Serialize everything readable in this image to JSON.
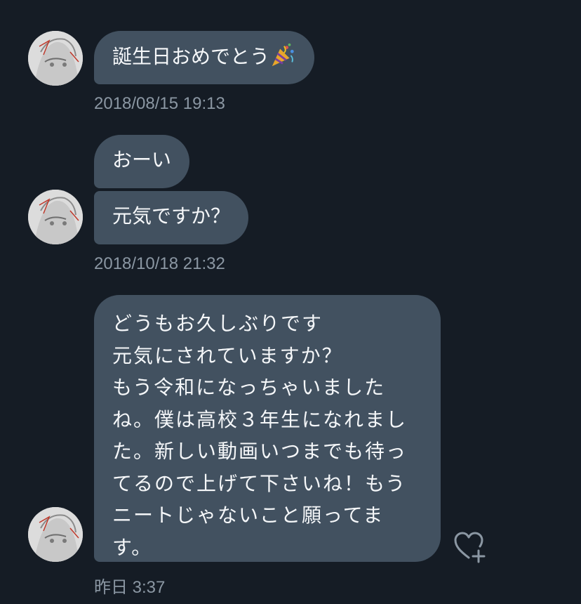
{
  "conversation": {
    "messages": [
      {
        "text": "誕生日おめでとう"
      },
      {
        "text": "おーい"
      },
      {
        "text": "元気ですか？"
      },
      {
        "lines": [
          "どうもお久しぶりです",
          "元気にされていますか？",
          "もう令和になっちゃいました",
          "ね。僕は高校３年生になれまし",
          "た。新しい動画いつまでも待っ",
          "てるので上げて下さいね！もう",
          "ニートじゃないこと願ってま",
          "す。"
        ]
      }
    ],
    "timestamps": [
      "2018/08/15 19:13",
      "2018/10/18 21:32",
      "昨日 3:37"
    ],
    "icons": {
      "avatar": "user-avatar",
      "emoji": "party-popper-icon",
      "like": "heart-plus-icon"
    },
    "colors": {
      "background": "#151c25",
      "bubble": "#425160",
      "timestamp": "#8b97a3"
    }
  }
}
